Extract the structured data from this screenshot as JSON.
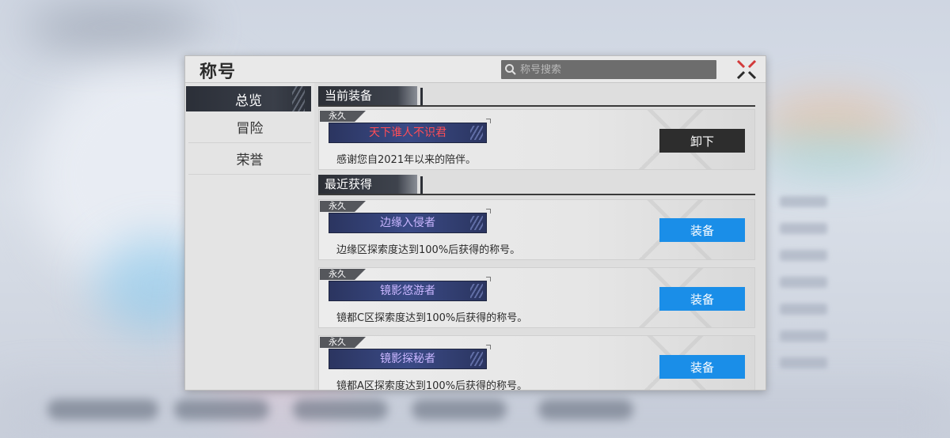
{
  "dialog": {
    "title": "称号",
    "search_placeholder": "称号搜索"
  },
  "nav": {
    "items": [
      {
        "label": "总览",
        "active": true
      },
      {
        "label": "冒险",
        "active": false
      },
      {
        "label": "荣誉",
        "active": false
      }
    ]
  },
  "sections": {
    "current": {
      "label": "当前装备"
    },
    "recent": {
      "label": "最近获得"
    }
  },
  "titles": [
    {
      "badge": "永久",
      "name": "天下谁人不识君",
      "name_color": "#ff4d57",
      "description": "感谢您自2021年以来的陪伴。",
      "action": "卸下"
    },
    {
      "badge": "永久",
      "name": "边缘入侵者",
      "name_color": "#c9b6ff",
      "description": "边缘区探索度达到100%后获得的称号。",
      "action": "装备"
    },
    {
      "badge": "永久",
      "name": "镜影悠游者",
      "name_color": "#c9b6ff",
      "description": "镜都C区探索度达到100%后获得的称号。",
      "action": "装备"
    },
    {
      "badge": "永久",
      "name": "镜影探秘者",
      "name_color": "#c9b6ff",
      "description": "镜都A区探索度达到100%后获得的称号。",
      "action": "装备"
    }
  ],
  "colors": {
    "equip_button": "#1a8ee8",
    "unequip_button": "#2d2d2d",
    "plate": "#3a4a86"
  }
}
